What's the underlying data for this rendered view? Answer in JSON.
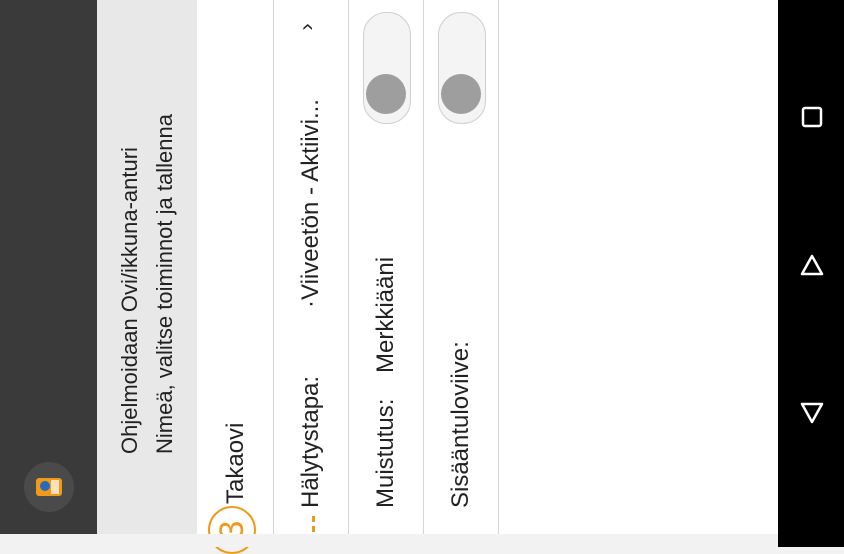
{
  "header": {
    "line1": "Ohjelmoidaan Ovi/ikkuna-anturi",
    "line2": "Nimeä, valitse toiminnot ja tallenna"
  },
  "step": {
    "number": "3"
  },
  "device": {
    "name": "Takaovi"
  },
  "rows": [
    {
      "label": "Hälytystapa:",
      "value": "·Viiveetön - Aktiivi..."
    },
    {
      "label": "Muistutus:",
      "value": "Merkkiääni"
    },
    {
      "label": "Sisääntuloviive:",
      "value": ""
    }
  ],
  "toggles": {
    "reminder_on": false,
    "entry_delay_on": false
  },
  "colors": {
    "accent": "#f09a1a",
    "appbar": "#3a3a3a",
    "navbar": "#000000"
  },
  "icons": {
    "logo": "app-logo-icon",
    "recent": "square-icon",
    "back": "back-triangle-icon",
    "home": "down-triangle-icon"
  }
}
